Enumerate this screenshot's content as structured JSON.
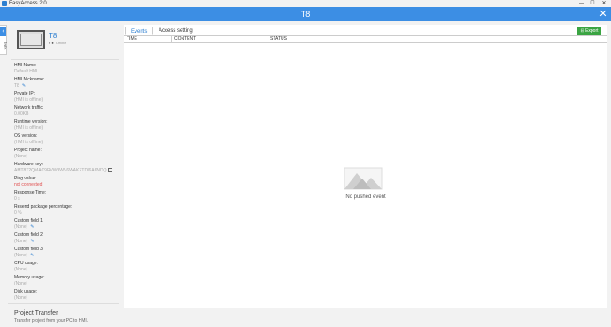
{
  "app": {
    "title": "EasyAccess 2.0"
  },
  "window_buttons": {
    "minimize": "—",
    "maximize": "☐",
    "close": "✕"
  },
  "header": {
    "title": "T8",
    "close_icon": "close-icon"
  },
  "info_tab": {
    "label": "Info",
    "arrow": "‹"
  },
  "device": {
    "name": "T8",
    "status_dots": "●●",
    "status": "Offline"
  },
  "fields": [
    {
      "label": "HMI Name:",
      "value": "Default HMI"
    },
    {
      "label": "HMI Nickname:",
      "value": "T8"
    },
    {
      "label": "Private IP:",
      "value": "(HMI is offline)"
    },
    {
      "label": "Network traffic:",
      "value": "0.00KB"
    },
    {
      "label": "Runtime version:",
      "value": "(HMI is offline)"
    },
    {
      "label": "OS version:",
      "value": "(HMI is offline)"
    },
    {
      "label": "Project name:",
      "value": "(None)"
    },
    {
      "label": "Hardware key:",
      "value": "AMT8T2QMAC9RVW9WV6WAKZTDI6A6NDQ"
    },
    {
      "label": "Ping value:",
      "value": "not connected"
    },
    {
      "label": "Response Time:",
      "value": "0 s"
    },
    {
      "label": "Resend package percentage:",
      "value": "0 %"
    },
    {
      "label": "Custom field 1:",
      "value": "(None)"
    },
    {
      "label": "Custom field 2:",
      "value": "(None)"
    },
    {
      "label": "Custom field 3:",
      "value": "(None)"
    },
    {
      "label": "CPU usage:",
      "value": "(None)"
    },
    {
      "label": "Memory usage:",
      "value": "(None)"
    },
    {
      "label": "Disk usage:",
      "value": "(None)"
    }
  ],
  "transfer": {
    "title": "Project Transfer",
    "subtitle": "Transfer project from your PC to HMI."
  },
  "tabs": [
    {
      "label": "Events",
      "active": true
    },
    {
      "label": "Access setting",
      "active": false
    }
  ],
  "export": {
    "label": "Export",
    "icon": "export-icon"
  },
  "table": {
    "columns": [
      "TIME",
      "CONTENT",
      "STATUS"
    ]
  },
  "empty": {
    "text": "No pushed event",
    "icon": "mountain-icon"
  },
  "colors": {
    "accent": "#3c8ee4",
    "export": "#3aa442",
    "error": "#e05050"
  }
}
